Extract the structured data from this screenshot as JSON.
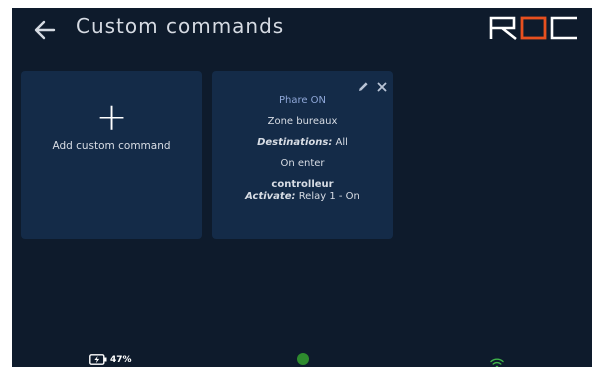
{
  "header": {
    "title": "Custom commands",
    "back_icon": "arrow-left-icon",
    "logo_text": "ROC"
  },
  "add_card": {
    "icon": "plus-icon",
    "label": "Add custom command"
  },
  "commands": [
    {
      "name": "Phare ON",
      "zone": "Zone bureaux",
      "destinations_label": "Destinations:",
      "destinations_value": "All",
      "trigger": "On enter",
      "device": "controlleur",
      "activate_label": "Activate:",
      "activate_value": "Relay 1 - On",
      "edit_icon": "pencil-icon",
      "delete_icon": "close-icon"
    }
  ],
  "status_bar": {
    "battery_percent": "47%",
    "battery_icon": "battery-charging-icon",
    "connection_icon": "status-dot-icon",
    "wifi_icon": "wifi-icon"
  },
  "colors": {
    "background": "#0e1b2c",
    "card": "#142b48",
    "accent": "#e8501f",
    "command_name": "#8fa7d8",
    "status_green": "#2e8b2e"
  }
}
